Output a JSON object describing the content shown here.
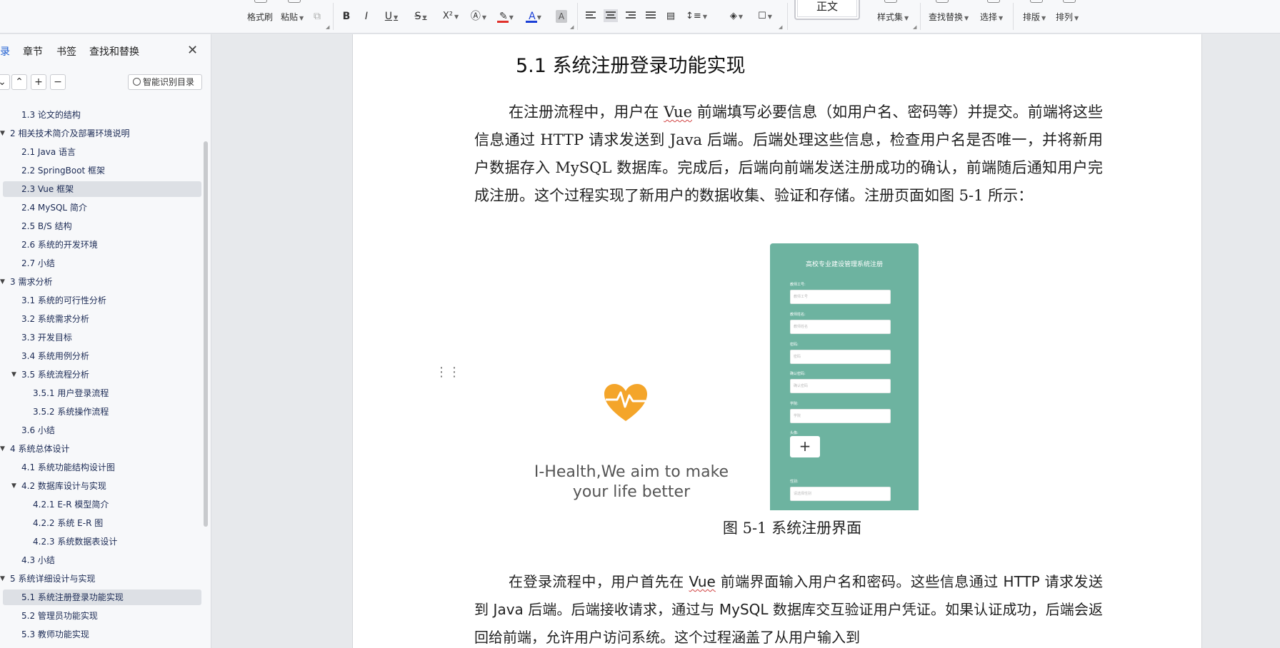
{
  "toolbar": {
    "format_painter": "格式刷",
    "paste": "粘贴",
    "bold": "B",
    "italic": "I",
    "underline": "U",
    "strikethrough": "S",
    "superscript": "X²",
    "style_normal": "正文",
    "style_set": "样式集",
    "find_replace": "查找替换",
    "select": "选择",
    "typeset": "排版",
    "arrange": "排列"
  },
  "sidebar": {
    "tabs": [
      {
        "label": "录",
        "active": true
      },
      {
        "label": "章节",
        "active": false
      },
      {
        "label": "书签",
        "active": false
      },
      {
        "label": "查找和替换",
        "active": false
      }
    ],
    "smart_toc_label": "智能识别目录",
    "items": [
      {
        "label": "1.3 论文的结构",
        "level": 2,
        "selected": false
      },
      {
        "label": "2 相关技术简介及部署环境说明",
        "level": 1,
        "selected": false
      },
      {
        "label": "2.1 Java 语言",
        "level": 2,
        "selected": false
      },
      {
        "label": "2.2 SpringBoot 框架",
        "level": 2,
        "selected": false
      },
      {
        "label": "2.3 Vue 框架",
        "level": 2,
        "selected": true
      },
      {
        "label": "2.4 MySQL 简介",
        "level": 2,
        "selected": false
      },
      {
        "label": "2.5 B/S 结构",
        "level": 2,
        "selected": false
      },
      {
        "label": "2.6 系统的开发环境",
        "level": 2,
        "selected": false
      },
      {
        "label": "2.7 小结",
        "level": 2,
        "selected": false
      },
      {
        "label": "3 需求分析",
        "level": 1,
        "selected": false
      },
      {
        "label": "3.1 系统的可行性分析",
        "level": 2,
        "selected": false
      },
      {
        "label": "3.2 系统需求分析",
        "level": 2,
        "selected": false
      },
      {
        "label": "3.3 开发目标",
        "level": 2,
        "selected": false
      },
      {
        "label": "3.4  系统用例分析",
        "level": 2,
        "selected": false
      },
      {
        "label": "3.5 系统流程分析",
        "level": 2,
        "expandable": true,
        "selected": false
      },
      {
        "label": "3.5.1  用户登录流程",
        "level": 3,
        "selected": false
      },
      {
        "label": "3.5.2  系统操作流程",
        "level": 3,
        "selected": false
      },
      {
        "label": "3.6 小结",
        "level": 2,
        "selected": false
      },
      {
        "label": "4 系统总体设计",
        "level": 1,
        "selected": false
      },
      {
        "label": "4.1 系统功能结构设计图",
        "level": 2,
        "selected": false
      },
      {
        "label": "4.2 数据库设计与实现",
        "level": 2,
        "expandable": true,
        "selected": false
      },
      {
        "label": "4.2.1    E-R 模型简介",
        "level": 3,
        "selected": false
      },
      {
        "label": "4.2.2    系统 E-R 图",
        "level": 3,
        "selected": false
      },
      {
        "label": "4.2.3  系统数据表设计",
        "level": 3,
        "selected": false
      },
      {
        "label": "4.3 小结",
        "level": 2,
        "selected": false
      },
      {
        "label": "5 系统详细设计与实现",
        "level": 1,
        "selected": false
      },
      {
        "label": "5.1 系统注册登录功能实现",
        "level": 2,
        "selected": true
      },
      {
        "label": "5.2 管理员功能实现",
        "level": 2,
        "selected": false
      },
      {
        "label": "5.3 教师功能实现",
        "level": 2,
        "selected": false
      }
    ]
  },
  "doc": {
    "section_title": "5.1 系统注册登录功能实现",
    "para1": "在注册流程中，用户在 Vue 前端填写必要信息（如用户名、密码等）并提交。前端将这些信息通过 HTTP 请求发送到 Java 后端。后端处理这些信息，检查用户名是否唯一，并将新用户数据存入 MySQL 数据库。完成后，后端向前端发送注册成功的确认，前端随后通知用户完成注册。这个过程实现了新用户的数据收集、验证和存储。注册页面如图 5-1 所示：",
    "figure": {
      "slogan": "I-Health,We aim to make your life better",
      "register_title": "高校专业建设管理系统注册",
      "fields": [
        {
          "label": "教师工号:",
          "placeholder": "教师工号"
        },
        {
          "label": "教师姓名:",
          "placeholder": "教师姓名"
        },
        {
          "label": "密码:",
          "placeholder": "密码"
        },
        {
          "label": "确认密码:",
          "placeholder": "确认密码"
        },
        {
          "label": "学院:",
          "placeholder": "学院"
        }
      ],
      "avatar_label": "头像:",
      "avatar_plus": "+",
      "gender_label": "性别:",
      "gender_placeholder": "请选择性别",
      "caption": "图 5-1  系统注册界面"
    },
    "para2": "在登录流程中，用户首先在 Vue 前端界面输入用户名和密码。这些信息通过 HTTP 请求发送到 Java 后端。后端接收请求，通过与 MySQL 数据库交互验证用户凭证。如果认证成功，后端会返回给前端，允许用户访问系统。这个过程涵盖了从用户输入到"
  },
  "colors": {
    "accent": "#1f5fd1",
    "register_bg": "#6db3a0",
    "heart": "#f4a52a",
    "font_red": "#e0302a",
    "font_blue": "#1a3fd6"
  }
}
